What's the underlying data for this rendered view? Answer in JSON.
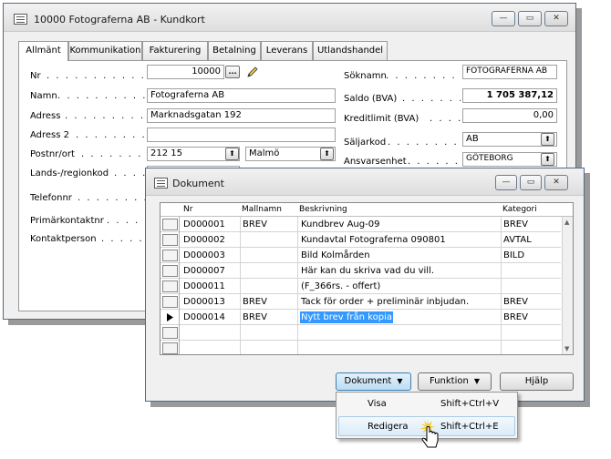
{
  "main_window": {
    "title": "10000 Fotograferna AB - Kundkort",
    "tabs": [
      "Allmänt",
      "Kommunikation",
      "Fakturering",
      "Betalning",
      "Leverans",
      "Utlandshandel"
    ],
    "left_fields": {
      "nr_label": "Nr",
      "nr_value": "10000",
      "namn_label": "Namn",
      "namn_value": "Fotograferna AB",
      "adress_label": "Adress",
      "adress_value": "Marknadsgatan 192",
      "adress2_label": "Adress 2",
      "adress2_value": "",
      "postnr_label": "Postnr/ort",
      "postnr_value": "212 15",
      "ort_value": "Malmö",
      "land_label": "Lands-/regionkod",
      "telefon_label": "Telefonnr",
      "primar_label": "Primärkontaktnr",
      "kontakt_label": "Kontaktperson"
    },
    "right_fields": {
      "soknamn_label": "Söknamn",
      "soknamn_value": "FOTOGRAFERNA AB",
      "saldo_label": "Saldo (BVA)",
      "saldo_value": "1 705 387,12",
      "kreditlimit_label": "Kreditlimit (BVA)",
      "kreditlimit_value": "0,00",
      "saljarkod_label": "Säljarkod",
      "saljarkod_value": "AB",
      "ansvar_label": "Ansvarsenhet",
      "ansvar_value": "GÖTEBORG"
    },
    "lookup_button": "...",
    "dots": ". . . . . . . . . . . . . . . . . . . ."
  },
  "doc_window": {
    "title": "Dokument",
    "columns": [
      "Nr",
      "Mallnamn",
      "Beskrivning",
      "Kategori"
    ],
    "rows": [
      {
        "nr": "D000001",
        "mall": "BREV",
        "beskr": "Kundbrev Aug-09",
        "kat": "BREV"
      },
      {
        "nr": "D000002",
        "mall": "",
        "beskr": "Kundavtal Fotograferna 090801",
        "kat": "AVTAL"
      },
      {
        "nr": "D000003",
        "mall": "",
        "beskr": "Bild Kolmården",
        "kat": "BILD"
      },
      {
        "nr": "D000007",
        "mall": "",
        "beskr": "Här kan du skriva vad du vill.",
        "kat": ""
      },
      {
        "nr": "D000011",
        "mall": "",
        "beskr": "(F_366rs. - offert)",
        "kat": ""
      },
      {
        "nr": "D000013",
        "mall": "BREV",
        "beskr": "Tack för order + preliminär inbjudan.",
        "kat": "BREV"
      },
      {
        "nr": "D000014",
        "mall": "BREV",
        "beskr": "Nytt brev från kopia",
        "kat": "BREV"
      }
    ],
    "buttons": {
      "dokument": "Dokument",
      "funktion": "Funktion",
      "hjalp": "Hjälp"
    }
  },
  "menu": {
    "items": [
      {
        "label": "Visa",
        "shortcut": "Shift+Ctrl+V"
      },
      {
        "label": "Redigera",
        "shortcut": "Shift+Ctrl+E"
      }
    ]
  },
  "colors": {
    "selection": "#3399ff",
    "menu_hover": "#d9ebf9"
  }
}
